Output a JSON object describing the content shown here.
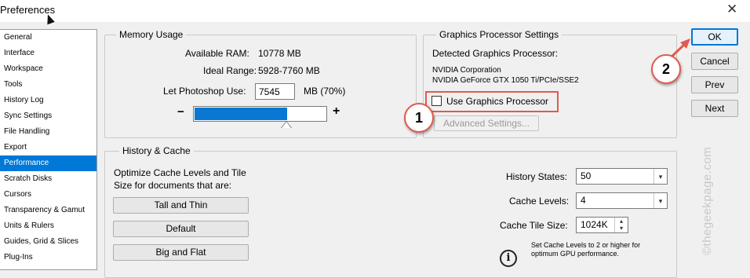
{
  "window": {
    "title": "Preferences",
    "close_glyph": "✕"
  },
  "sidebar": {
    "items": [
      {
        "label": "General"
      },
      {
        "label": "Interface"
      },
      {
        "label": "Workspace"
      },
      {
        "label": "Tools"
      },
      {
        "label": "History Log"
      },
      {
        "label": "Sync Settings"
      },
      {
        "label": "File Handling"
      },
      {
        "label": "Export"
      },
      {
        "label": "Performance",
        "selected": true
      },
      {
        "label": "Scratch Disks"
      },
      {
        "label": "Cursors"
      },
      {
        "label": "Transparency & Gamut"
      },
      {
        "label": "Units & Rulers"
      },
      {
        "label": "Guides, Grid & Slices"
      },
      {
        "label": "Plug-Ins"
      }
    ]
  },
  "memory": {
    "legend": "Memory Usage",
    "available_label": "Available RAM:",
    "available_value": "10778 MB",
    "ideal_label": "Ideal Range:",
    "ideal_value": "5928-7760 MB",
    "use_label": "Let Photoshop Use:",
    "use_value": "7545",
    "use_suffix": "MB (70%)",
    "minus": "−",
    "plus": "+",
    "slider_fraction": 0.7
  },
  "gpu": {
    "legend": "Graphics Processor Settings",
    "detected_label": "Detected Graphics Processor:",
    "vendor": "NVIDIA Corporation",
    "model": "NVIDIA GeForce GTX 1050 Ti/PCIe/SSE2",
    "use_gpu_label": "Use Graphics Processor",
    "use_gpu_checked": false,
    "advanced_button": "Advanced Settings..."
  },
  "history": {
    "legend": "History & Cache",
    "optimize_text_1": "Optimize Cache Levels and Tile",
    "optimize_text_2": "Size for documents that are:",
    "tall_thin": "Tall and Thin",
    "default": "Default",
    "big_flat": "Big and Flat",
    "history_states_label": "History States:",
    "history_states_value": "50",
    "cache_levels_label": "Cache Levels:",
    "cache_levels_value": "4",
    "cache_tile_label": "Cache Tile Size:",
    "cache_tile_value": "1024K",
    "note_1": "Set Cache Levels to 2 or higher for",
    "note_2": "optimum GPU performance."
  },
  "buttons": {
    "ok": "OK",
    "cancel": "Cancel",
    "prev": "Prev",
    "next": "Next"
  },
  "annotations": {
    "callout_1": "1",
    "callout_2": "2",
    "watermark": "©thegeekpage.com"
  },
  "colors": {
    "accent": "#0078d7",
    "highlight": "#e05a4f"
  }
}
